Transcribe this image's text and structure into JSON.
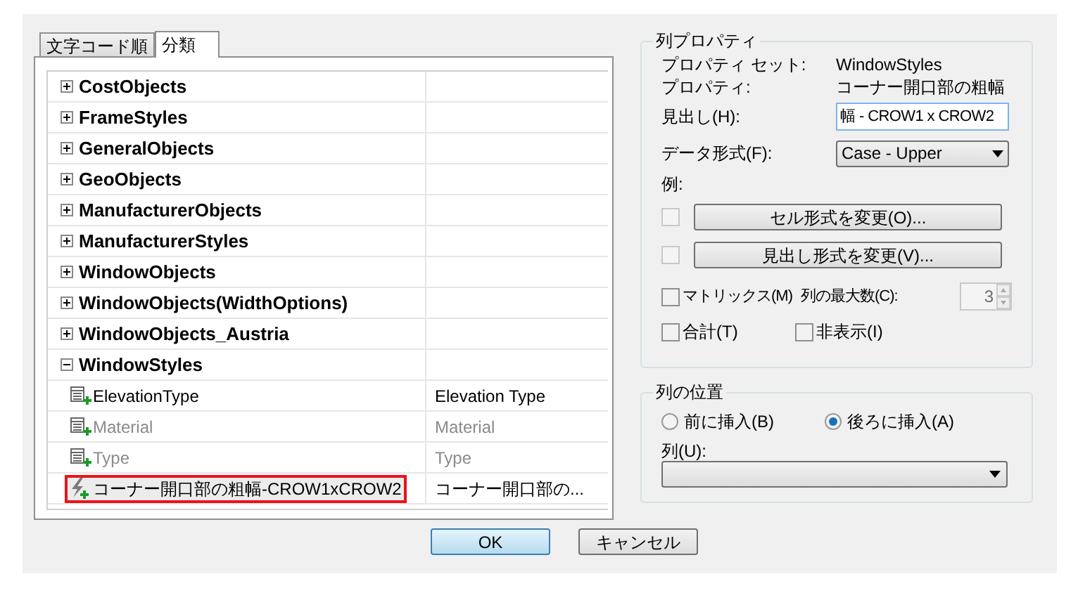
{
  "tabs": [
    {
      "label": "文字コード順",
      "selected": false
    },
    {
      "label": "分類",
      "selected": true
    }
  ],
  "tree": [
    {
      "name": "CostObjects",
      "expanded": false
    },
    {
      "name": "FrameStyles",
      "expanded": false
    },
    {
      "name": "GeneralObjects",
      "expanded": false
    },
    {
      "name": "GeoObjects",
      "expanded": false
    },
    {
      "name": "ManufacturerObjects",
      "expanded": false
    },
    {
      "name": "ManufacturerStyles",
      "expanded": false
    },
    {
      "name": "WindowObjects",
      "expanded": false
    },
    {
      "name": "WindowObjects(WidthOptions)",
      "expanded": false
    },
    {
      "name": "WindowObjects_Austria",
      "expanded": false
    },
    {
      "name": "WindowStyles",
      "expanded": true,
      "children": [
        {
          "kind": "property",
          "name": "ElevationType",
          "value": "Elevation Type",
          "disabled": false,
          "selected": false
        },
        {
          "kind": "property",
          "name": "Material",
          "value": "Material",
          "disabled": true,
          "selected": false
        },
        {
          "kind": "property",
          "name": "Type",
          "value": "Type",
          "disabled": true,
          "selected": false
        },
        {
          "kind": "formula",
          "name": "コーナー開口部の粗幅-CROW1xCROW2",
          "value": "コーナー開口部の...",
          "disabled": false,
          "selected": true
        }
      ]
    }
  ],
  "column_properties": {
    "title": "列プロパティ",
    "property_set_label": "プロパティ セット:",
    "property_set": "WindowStyles",
    "property_label": "プロパティ:",
    "property": "コーナー開口部の粗幅",
    "heading_label": "見出し(H):",
    "heading_value": "幅 - CROW1 x CROW2",
    "data_format_label": "データ形式(F):",
    "data_format": "Case - Upper",
    "example_label": "例:",
    "cell_format_button": "セル形式を変更(O)...",
    "cell_format_checked": false,
    "heading_format_button": "見出し形式を変更(V)...",
    "heading_format_checked": false,
    "matrix_label": "マトリックス(M)",
    "matrix_checked": false,
    "max_columns_label": "列の最大数(C):",
    "max_columns": "3",
    "total_label": "合計(T)",
    "total_checked": false,
    "hidden_label": "非表示(I)",
    "hidden_checked": false
  },
  "column_position": {
    "title": "列の位置",
    "options": [
      {
        "label": "前に挿入(B)",
        "selected": false
      },
      {
        "label": "後ろに挿入(A)",
        "selected": true
      }
    ],
    "column_label": "列(U):"
  },
  "buttons": [
    {
      "label": "OK",
      "default": true
    },
    {
      "label": "キャンセル",
      "default": false
    }
  ]
}
